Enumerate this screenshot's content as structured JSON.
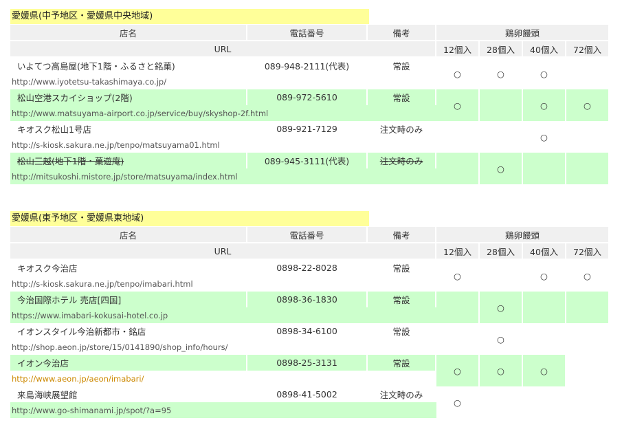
{
  "sections": [
    {
      "title": "愛媛県(中予地区・愛媛県中央地域)",
      "headers": {
        "name": "店名",
        "tel": "電話番号",
        "note": "備考",
        "product": "鶏卵饅頭",
        "url": "URL",
        "sizes": [
          "12個入",
          "28個入",
          "40個入",
          "72個入"
        ]
      },
      "rows": [
        {
          "name": "いよてつ高島屋(地下1階・ふるさと銘菓)",
          "tel": "089-948-2111(代表)",
          "note": "常設",
          "url": "http://www.iyotetsu-takashimaya.co.jp/",
          "marks": [
            "○",
            "○",
            "○",
            ""
          ]
        },
        {
          "name": "松山空港スカイショップ(2階)",
          "tel": "089-972-5610",
          "note": "常設",
          "url": "http://www.matsuyama-airport.co.jp/service/buy/skyshop-2f.html",
          "marks": [
            "○",
            "",
            "○",
            "○"
          ]
        },
        {
          "name": "キオスク松山1号店",
          "tel": "089-921-7129",
          "note": "注文時のみ",
          "url": "http://s-kiosk.sakura.ne.jp/tenpo/matsuyama01.html",
          "marks": [
            "",
            "",
            "○",
            ""
          ]
        },
        {
          "name": "松山三越(地下1階・菓遊庵)",
          "tel": "089-945-3111(代表)",
          "note": "注文時のみ",
          "url": "http://mitsukoshi.mistore.jp/store/matsuyama/index.html",
          "marks": [
            "",
            "○",
            "",
            ""
          ]
        }
      ]
    },
    {
      "title": "愛媛県(東予地区・愛媛県東地域)",
      "headers": {
        "name": "店名",
        "tel": "電話番号",
        "note": "備考",
        "product": "鶏卵饅頭",
        "url": "URL",
        "sizes": [
          "12個入",
          "28個入",
          "40個入",
          "72個入"
        ]
      },
      "rows": [
        {
          "name": "キオスク今治店",
          "tel": "0898-22-8028",
          "note": "常設",
          "url": "http://s-kiosk.sakura.ne.jp/tenpo/imabari.html",
          "marks": [
            "○",
            "",
            "○",
            "○"
          ]
        },
        {
          "name": "今治国際ホテル 売店[四国]",
          "tel": "0898-36-1830",
          "note": "常設",
          "url": "https://www.imabari-kokusai-hotel.co.jp",
          "marks": [
            "",
            "○",
            "",
            ""
          ]
        },
        {
          "name": "イオンスタイル今治新都市・銘店",
          "tel": "0898-34-6100",
          "note": "常設",
          "url": "http://shop.aeon.jp/store/15/0141890/shop_info/hours/",
          "marks": [
            "",
            "○",
            "",
            ""
          ]
        },
        {
          "name": "イオン今治店",
          "tel": "0898-25-3131",
          "note": "常設",
          "url": "http://www.aeon.jp/aeon/imabari/",
          "marks": [
            "○",
            "○",
            "○",
            ""
          ]
        },
        {
          "name": "来島海峡展望館",
          "tel": "0898-41-5002",
          "note": "注文時のみ",
          "url": "http://www.go-shimanami.jp/spot/?a=95",
          "marks": [
            "○",
            "",
            "",
            ""
          ]
        }
      ]
    }
  ]
}
